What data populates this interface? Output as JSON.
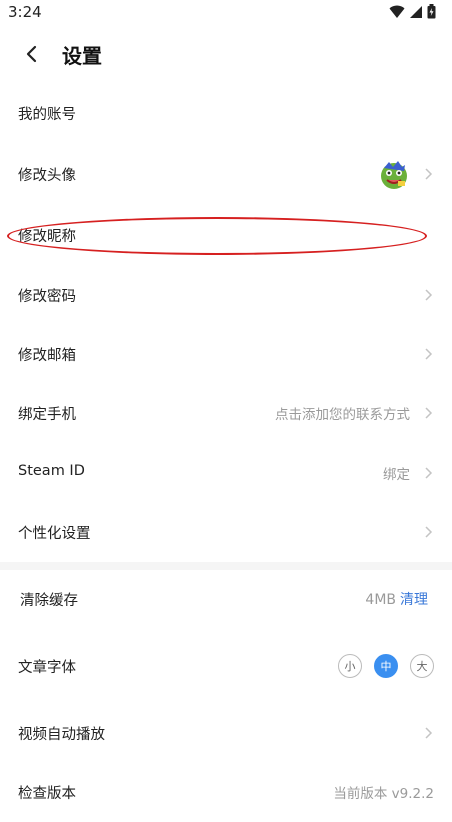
{
  "status": {
    "time": "3:24"
  },
  "header": {
    "title": "设置"
  },
  "rows": [
    {
      "label": "我的账号"
    },
    {
      "label": "修改头像"
    },
    {
      "label": "修改昵称"
    },
    {
      "label": "修改密码"
    },
    {
      "label": "修改邮箱"
    },
    {
      "label": "绑定手机",
      "value": "点击添加您的联系方式"
    },
    {
      "label": "Steam ID",
      "value": "绑定"
    },
    {
      "label": "个性化设置"
    }
  ],
  "cache": {
    "label": "清除缓存",
    "size": "4MB",
    "action": "清理"
  },
  "font": {
    "label": "文章字体",
    "options": [
      "小",
      "中",
      "大"
    ],
    "selected": "中"
  },
  "video": {
    "label": "视频自动播放"
  },
  "version": {
    "label": "检查版本",
    "value": "当前版本 v9.2.2"
  },
  "colors": {
    "accent": "#3a8ff0",
    "link": "#3a78d8",
    "highlight": "#d62020"
  }
}
